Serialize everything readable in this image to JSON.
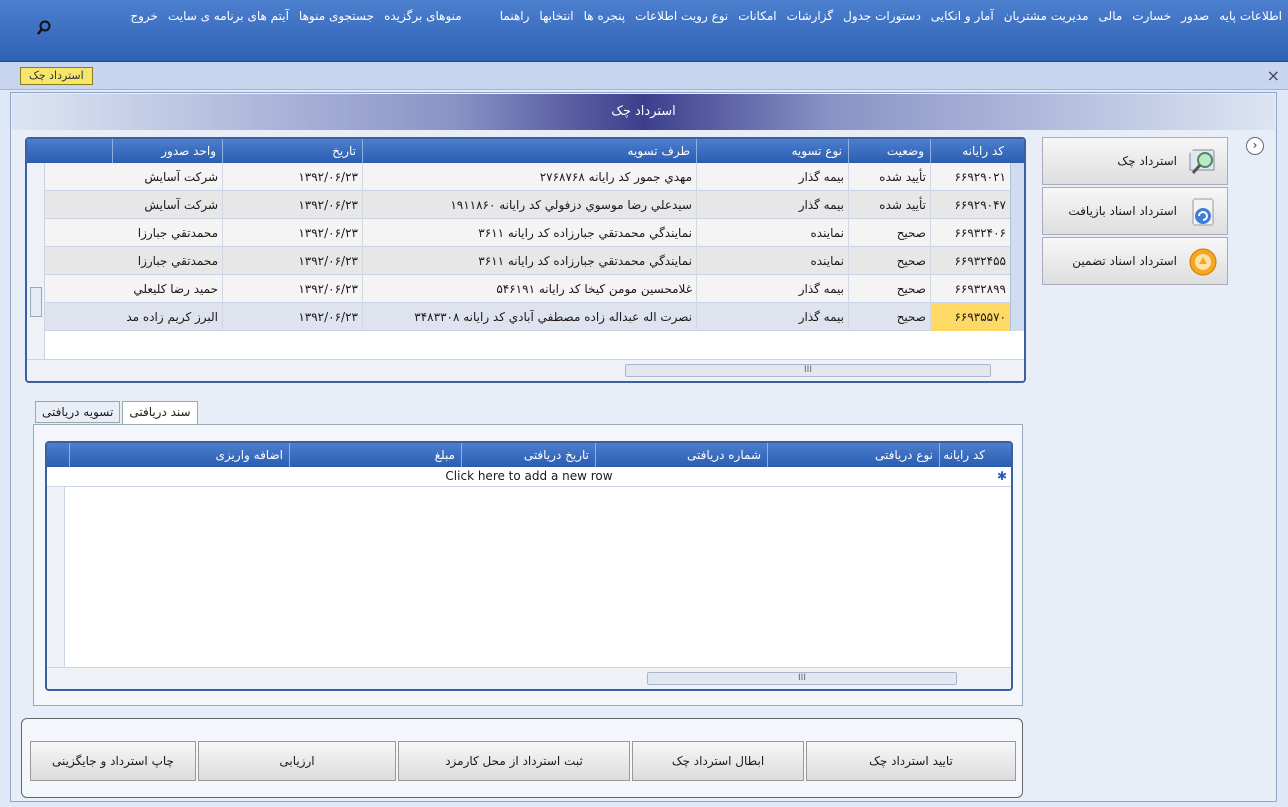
{
  "menu": {
    "items": [
      "اطلاعات پایه",
      "صدور",
      "خسارت",
      "مالی",
      "مدیریت مشتریان",
      "آمار و انکایی",
      "دستورات جدول",
      "گزارشات",
      "امکانات",
      "نوع رویت اطلاعات",
      "پنجره ها",
      "انتخابها",
      "راهنما"
    ],
    "favorites": "منوهای برگزیده",
    "search": "جستجوی منوها",
    "site_items": "آیتم های برنامه ی سایت",
    "exit": "خروج"
  },
  "tabs": {
    "active": "استرداد چک"
  },
  "panel": {
    "title": "استرداد چک"
  },
  "main_grid": {
    "columns": [
      "کد رایانه",
      "وضعیت",
      "نوع تسویه",
      "طرف تسویه",
      "تاریخ",
      "واحد صدور"
    ],
    "rows": [
      [
        "۶۶۹۲۹۰۲۱",
        "تأیید شده",
        "بیمه گذار",
        "مهدي جمور كد رايانه ۲۷۶۸۷۶۸",
        "۱۳۹۲/۰۶/۲۳",
        "شرکت آسایش"
      ],
      [
        "۶۶۹۲۹۰۴۷",
        "تأیید شده",
        "بیمه گذار",
        "سیدعلي رضا موسوي دزفولي كد رايانه ۱۹۱۱۸۶۰",
        "۱۳۹۲/۰۶/۲۳",
        "شرکت آسایش"
      ],
      [
        "۶۶۹۳۲۴۰۶",
        "صحیح",
        "نماینده",
        "نمايندگي محمدتقي جبارزاده كد رايانه ۳۶۱۱",
        "۱۳۹۲/۰۶/۲۳",
        "محمدتقي جبارزا"
      ],
      [
        "۶۶۹۳۲۴۵۵",
        "صحیح",
        "نماینده",
        "نمايندگي محمدتقي جبارزاده كد رايانه ۳۶۱۱",
        "۱۳۹۲/۰۶/۲۳",
        "محمدتقي جبارزا"
      ],
      [
        "۶۶۹۳۲۸۹۹",
        "صحیح",
        "بیمه گذار",
        "غلامحسين مومن كيخا كد رايانه ۵۴۶۱۹۱",
        "۱۳۹۲/۰۶/۲۳",
        "حميد رضا كليعلي"
      ],
      [
        "۶۶۹۳۵۵۷۰",
        "صحیح",
        "بیمه گذار",
        "نصرت اله عبداله زاده مصطفي آبادي كد رايانه ۳۴۸۳۳۰۸",
        "۱۳۹۲/۰۶/۲۳",
        "البرز كريم زاده مد"
      ]
    ]
  },
  "side_menu": {
    "items": [
      "استرداد چک",
      "استرداد اسناد بازیافت",
      "استرداد اسناد تضمین"
    ]
  },
  "sub_tabs": [
    "سند دریافتی",
    "تسویه دریافتی"
  ],
  "detail_grid": {
    "columns": [
      "کد رایانه",
      "نوع دریافتی",
      "شماره دریافتی",
      "تاریخ دریافتی",
      "مبلغ",
      "اضافه واریزی"
    ],
    "new_row": "Click here to add a new row"
  },
  "footer": {
    "buttons": [
      "تایید استرداد چک",
      "ابطال استرداد چک",
      "ثبت استرداد از محل کارمزد",
      "ارزیابی",
      "چاپ استرداد و جایگزینی"
    ]
  },
  "scroll_glyph": "III"
}
